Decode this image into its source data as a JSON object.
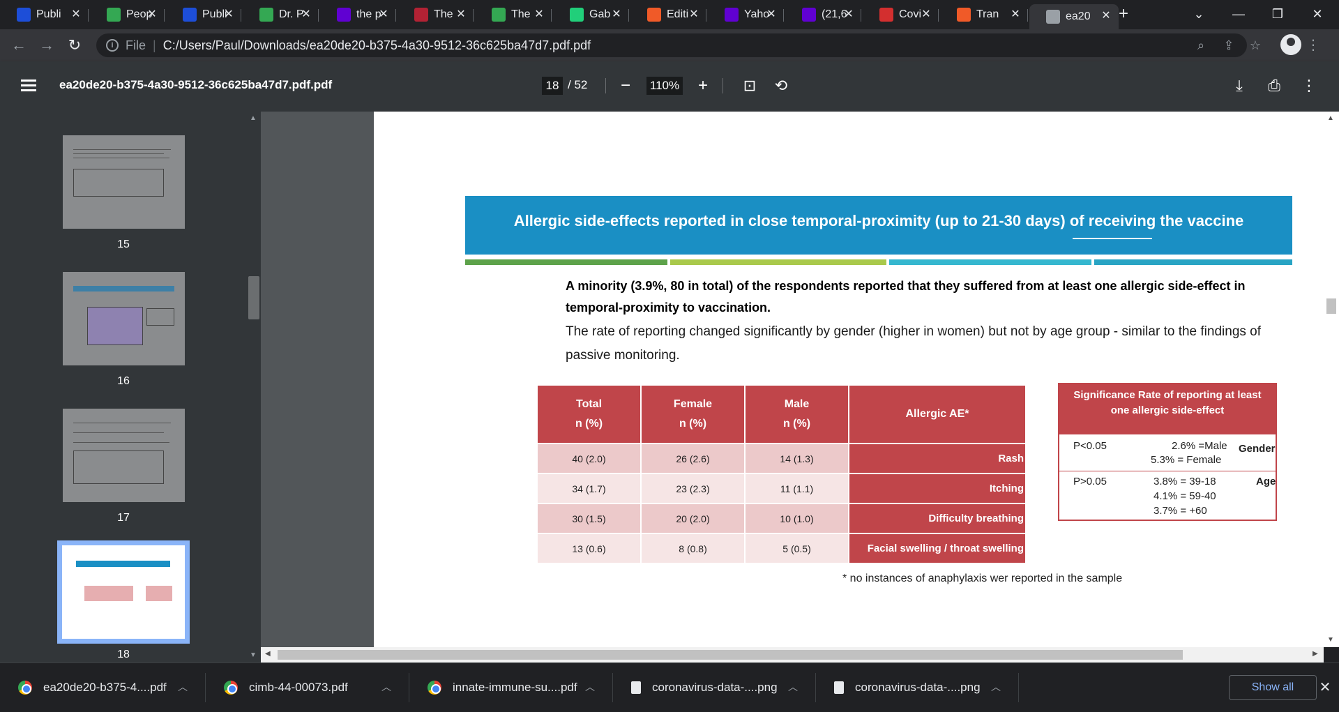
{
  "tabs": [
    {
      "title": "Publi",
      "favicon": "news-favicon-icon",
      "color": "#1d4ed8"
    },
    {
      "title": "Peop",
      "favicon": "play-favicon-icon",
      "color": "#34a853"
    },
    {
      "title": "Publi",
      "favicon": "news-favicon-icon",
      "color": "#1d4ed8"
    },
    {
      "title": "Dr. P",
      "favicon": "play-favicon-icon",
      "color": "#34a853"
    },
    {
      "title": "the p",
      "favicon": "yahoo-favicon-icon",
      "color": "#6001d2"
    },
    {
      "title": "The",
      "favicon": "us-flag-favicon-icon",
      "color": "#b22234"
    },
    {
      "title": "The",
      "favicon": "play-favicon-icon",
      "color": "#34a853"
    },
    {
      "title": "Gab",
      "favicon": "gab-favicon-icon",
      "color": "#21cf7a"
    },
    {
      "title": "Editi",
      "favicon": "bookmark-favicon-icon",
      "color": "#f05a28"
    },
    {
      "title": "Yaho",
      "favicon": "yahoo-favicon-icon",
      "color": "#6001d2"
    },
    {
      "title": "(21,6",
      "favicon": "mail-favicon-icon",
      "color": "#6001d2"
    },
    {
      "title": "Covi",
      "favicon": "news-favicon-icon",
      "color": "#d32f2f"
    },
    {
      "title": "Tran",
      "favicon": "bookmark-favicon-icon",
      "color": "#f05a28"
    },
    {
      "title": "ea20",
      "favicon": "globe-favicon-icon",
      "color": "#9aa0a6",
      "active": true
    }
  ],
  "address": {
    "file_label": "File",
    "url": "C:/Users/Paul/Downloads/ea20de20-b375-4a30-9512-36c625ba47d7.pdf.pdf"
  },
  "pdf_toolbar": {
    "filename": "ea20de20-b375-4a30-9512-36c625ba47d7.pdf.pdf",
    "current_page": "18",
    "total_pages": "/ 52",
    "zoom": "110%"
  },
  "thumbnails": [
    {
      "label": "15"
    },
    {
      "label": "16"
    },
    {
      "label": "17"
    },
    {
      "label": "18",
      "selected": true
    }
  ],
  "slide": {
    "banner_title": "Allergic side-effects reported in close temporal-proximity (up to 21-30 days) of receiving the vaccine",
    "para_bold": "A minority (3.9%, 80 in total) of the respondents reported that they suffered from at least one allergic side-effect in temporal-proximity to vaccination.",
    "para_normal": "The rate of reporting changed significantly by gender (higher in women) but not by age group - similar to the findings of passive monitoring.",
    "table": {
      "headers": {
        "total": "Total",
        "total_sub": "n (%)",
        "female": "Female",
        "female_sub": "n (%)",
        "male": "Male",
        "male_sub": "n (%)",
        "ae": "Allergic AE*"
      },
      "rows": [
        {
          "total": "40 (2.0)",
          "female": "26 (2.6)",
          "male": "14 (1.3)",
          "ae": "Rash"
        },
        {
          "total": "34 (1.7)",
          "female": "23 (2.3)",
          "male": "11 (1.1)",
          "ae": "Itching"
        },
        {
          "total": "30 (1.5)",
          "female": "20 (2.0)",
          "male": "10 (1.0)",
          "ae": "Difficulty breathing"
        },
        {
          "total": "13 (0.6)",
          "female": "8 (0.8)",
          "male": "5 (0.5)",
          "ae": "Facial swelling / throat swelling"
        }
      ]
    },
    "significance": {
      "header_line1": "Significance Rate of reporting at least",
      "header_line2": "one allergic side-effect",
      "gender_p": "P<0.05",
      "gender_line1": "2.6% =Male",
      "gender_line2": "5.3%  = Female",
      "gender_label": "Gender",
      "age_p": "P>0.05",
      "age_line1": "3.8% = 39-18",
      "age_line2": "4.1% = 59-40",
      "age_line3": "3.7% =   +60",
      "age_label": "Age"
    },
    "footnote": "* no instances of anaphylaxis wer reported in the sample"
  },
  "downloads": [
    {
      "name": "ea20de20-b375-4....pdf",
      "type": "chrome"
    },
    {
      "name": "cimb-44-00073.pdf",
      "type": "chrome"
    },
    {
      "name": "innate-immune-su....pdf",
      "type": "chrome"
    },
    {
      "name": "coronavirus-data-....png",
      "type": "file"
    },
    {
      "name": "coronavirus-data-....png",
      "type": "file"
    }
  ],
  "download_bar": {
    "show_all": "Show all"
  },
  "colors": {
    "banner": "#1a8fc4",
    "table_header": "#c0454a",
    "row_dark": "#ecc9ca",
    "row_light": "#f6e5e5"
  }
}
